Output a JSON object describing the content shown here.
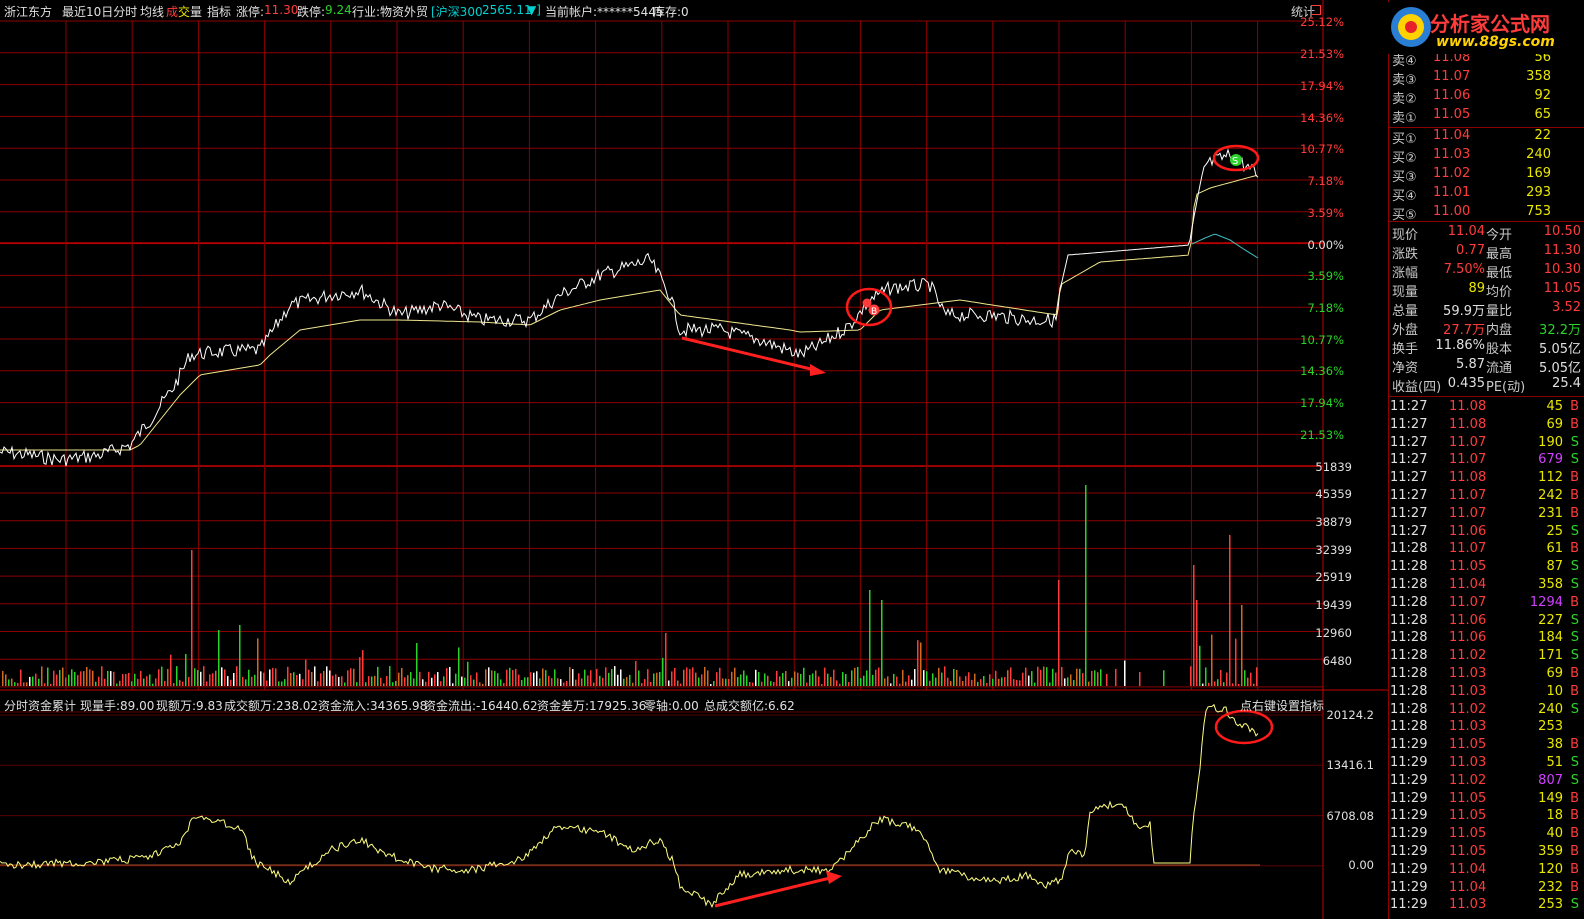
{
  "header": {
    "stock_name": "浙江东方",
    "period": "最近10日分时",
    "avg_line": "均线",
    "volume_label_a": "成",
    "volume_label_b": "交",
    "volume_label_c": "量",
    "indicator": "指标",
    "limit_up_label": "涨停:",
    "limit_up": "11.30",
    "limit_down_label": "跌停:",
    "limit_down": "9.24",
    "industry": "行业:物资外贸",
    "index_name": "[沪深300",
    "index_value": "2565.11",
    "index_arrow": "▼]",
    "account": "当前帐户:******5445",
    "stock_hold": "库存:0",
    "stats_button": "统计"
  },
  "price_axis": [
    "25.12%",
    "21.53%",
    "17.94%",
    "14.36%",
    "10.77%",
    "7.18%",
    "3.59%",
    "0.00%",
    "3.59%",
    "7.18%",
    "10.77%",
    "14.36%",
    "17.94%",
    "21.53%"
  ],
  "volume_axis": [
    "51839",
    "45359",
    "38879",
    "32399",
    "25919",
    "19439",
    "12960",
    "6480"
  ],
  "flow_axis": [
    "20124.2",
    "13416.1",
    "6708.08",
    "0.00"
  ],
  "indicator_bar": {
    "name": "分时资金累计",
    "now_hand": "现量手:89.00",
    "now_amount": "现额万:9.83",
    "turnover": "成交额万:238.02",
    "inflow": "资金流入:34365.98",
    "outflow": "资金流出:-16440.62",
    "diff": "资金差万:17925.36",
    "zero_axis": "零轴:0.00",
    "total": "总成交额亿:6.62",
    "settings": "点右键设置指标"
  },
  "logo": {
    "title": "分析家公式网",
    "url": "www.88gs.com"
  },
  "orderbook": {
    "sell": [
      {
        "label": "卖④",
        "price": "11.08",
        "vol": "56"
      },
      {
        "label": "卖③",
        "price": "11.07",
        "vol": "358"
      },
      {
        "label": "卖②",
        "price": "11.06",
        "vol": "92"
      },
      {
        "label": "卖①",
        "price": "11.05",
        "vol": "65"
      }
    ],
    "buy": [
      {
        "label": "买①",
        "price": "11.04",
        "vol": "22"
      },
      {
        "label": "买②",
        "price": "11.03",
        "vol": "240"
      },
      {
        "label": "买③",
        "price": "11.02",
        "vol": "169"
      },
      {
        "label": "买④",
        "price": "11.01",
        "vol": "293"
      },
      {
        "label": "买⑤",
        "price": "11.00",
        "vol": "753"
      }
    ]
  },
  "quote": [
    {
      "l1": "现价",
      "v1": "11.04",
      "l2": "今开",
      "v2": "10.50"
    },
    {
      "l1": "涨跌",
      "v1": "0.77",
      "l2": "最高",
      "v2": "11.30"
    },
    {
      "l1": "涨幅",
      "v1": "7.50%",
      "l2": "最低",
      "v2": "10.30"
    },
    {
      "l1": "现量",
      "v1": "89",
      "l2": "均价",
      "v2": "11.05"
    },
    {
      "l1": "总量",
      "v1": "59.9万",
      "l2": "量比",
      "v2": "3.52"
    },
    {
      "l1": "外盘",
      "v1": "27.7万",
      "l2": "内盘",
      "v2": "32.2万"
    },
    {
      "l1": "换手",
      "v1": "11.86%",
      "l2": "股本",
      "v2": "5.05亿"
    },
    {
      "l1": "净资",
      "v1": "5.87",
      "l2": "流通",
      "v2": "5.05亿"
    },
    {
      "l1": "收益(四)",
      "v1": "0.435",
      "l2": "PE(动)",
      "v2": "25.4"
    }
  ],
  "ticks": [
    {
      "t": "11:27",
      "p": "11.08",
      "v": "45",
      "s": "B"
    },
    {
      "t": "11:27",
      "p": "11.08",
      "v": "69",
      "s": "B"
    },
    {
      "t": "11:27",
      "p": "11.07",
      "v": "190",
      "s": "S"
    },
    {
      "t": "11:27",
      "p": "11.07",
      "v": "679",
      "s": "S"
    },
    {
      "t": "11:27",
      "p": "11.08",
      "v": "112",
      "s": "B"
    },
    {
      "t": "11:27",
      "p": "11.07",
      "v": "242",
      "s": "B"
    },
    {
      "t": "11:27",
      "p": "11.07",
      "v": "231",
      "s": "B"
    },
    {
      "t": "11:27",
      "p": "11.06",
      "v": "25",
      "s": "S"
    },
    {
      "t": "11:28",
      "p": "11.07",
      "v": "61",
      "s": "B"
    },
    {
      "t": "11:28",
      "p": "11.05",
      "v": "87",
      "s": "S"
    },
    {
      "t": "11:28",
      "p": "11.04",
      "v": "358",
      "s": "S"
    },
    {
      "t": "11:28",
      "p": "11.07",
      "v": "1294",
      "s": "B"
    },
    {
      "t": "11:28",
      "p": "11.06",
      "v": "227",
      "s": "S"
    },
    {
      "t": "11:28",
      "p": "11.06",
      "v": "184",
      "s": "S"
    },
    {
      "t": "11:28",
      "p": "11.02",
      "v": "171",
      "s": "S"
    },
    {
      "t": "11:28",
      "p": "11.03",
      "v": "69",
      "s": "B"
    },
    {
      "t": "11:28",
      "p": "11.03",
      "v": "10",
      "s": "B"
    },
    {
      "t": "11:28",
      "p": "11.02",
      "v": "240",
      "s": "S"
    },
    {
      "t": "11:28",
      "p": "11.03",
      "v": "253",
      "s": ""
    },
    {
      "t": "11:29",
      "p": "11.05",
      "v": "38",
      "s": "B"
    },
    {
      "t": "11:29",
      "p": "11.03",
      "v": "51",
      "s": "S"
    },
    {
      "t": "11:29",
      "p": "11.02",
      "v": "807",
      "s": "S"
    },
    {
      "t": "11:29",
      "p": "11.05",
      "v": "149",
      "s": "B"
    },
    {
      "t": "11:29",
      "p": "11.05",
      "v": "18",
      "s": "B"
    },
    {
      "t": "11:29",
      "p": "11.05",
      "v": "40",
      "s": "B"
    },
    {
      "t": "11:29",
      "p": "11.05",
      "v": "359",
      "s": "B"
    },
    {
      "t": "11:29",
      "p": "11.04",
      "v": "120",
      "s": "B"
    },
    {
      "t": "11:29",
      "p": "11.04",
      "v": "232",
      "s": "B"
    },
    {
      "t": "11:29",
      "p": "11.03",
      "v": "253",
      "s": "S"
    }
  ],
  "markers": {
    "buy": "B",
    "sell": "S"
  },
  "colors": {
    "grid": "#8b0000",
    "up": "#ff3c3c",
    "down": "#2ad32a",
    "price_line": "#ffffff",
    "avg_line": "#f0e68c",
    "flow_line": "#ffff80",
    "purple_vol": "#d040ff"
  }
}
